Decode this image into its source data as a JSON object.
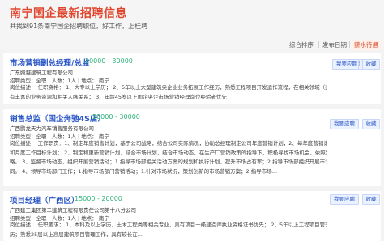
{
  "header": {
    "title": "南宁国企最新招聘信息",
    "subtitle": "共找到91条南宁国企招聘职位，好工作，上桂聘"
  },
  "sort": {
    "options": [
      "综合排序",
      "发布日期",
      "薪水待遇"
    ],
    "active": "薪水待遇"
  },
  "buttons": {
    "apply": "我要应聘",
    "collect": "收藏"
  },
  "jobs": [
    {
      "title": "市场营销副总经理/总监",
      "salary": "20000 - 30000",
      "company": "广东腾越建筑工程有限公司",
      "meta": "招聘类型：全职 | 人数：1人 | 地点：  南宁",
      "desc": [
        "岗位描述：  任职资格： 1、大专以上学历； 2、5年以上大型建筑央企业业务拓展工作经历，熟悉工程项目开发运作流程，在相关领域（建筑、房地产等行业）",
        "有丰富的业务资源和相关人脉关系； 3、年龄45岁以上国企央企市场营销经理岗位经验者优先"
      ]
    },
    {
      "title": "销售总监（国企奔驰4S店）",
      "salary": "20000 - 30000",
      "company": "广西鹏龙天力汽车销售服务有限公司",
      "meta": "招聘类型：全职 | 人数：1人 | 地点：  南宁",
      "desc": [
        "岗位描述：  工作职责：1、制定年度销售计划，基于公司战略，结合公司实际情况，协助总经理制定公司年度营销计划；2、每年度营销计划，进一步和业季度",
        "和月度工作目标计划； 2、制定和更新营销计划，结合市场计划，结合市场动态，在生产厂营销政策的指导下，积极寻找市场机会，依照公司整体营销计划，调整营销策",
        "略。 3、监督市场动态，组织开展营销活动；1.指导市场部相关活动方案的规划和执行计划，提升市场占有率；2.指导市场部组织开展市场分析报告，与总经理和其他业务部门协",
        "同。 4、领导市场部门工作；1.指导市场部门营销活动；1.针对市场状况，策划创新的市场营销方案；2.指导市场..."
      ]
    },
    {
      "title": "项目经理（广西区）",
      "salary": "15000 - 20000",
      "company": "广西建工集团第二建筑工程有限责任公司第十八分公司",
      "meta": "招聘类型：全职 | 人数：1人 | 地点：  南宁",
      "desc": [
        "岗位描述：  任职要求： 1、本科及以上学历，土木工程类等相关专业，具有项目一级建造师执业资格证书优先； 2、5年以上工程项目管理经验，有同类国企央企工作经",
        "历；熟悉25层以上高层建筑项目管理工作，具有较长在..."
      ]
    }
  ]
}
